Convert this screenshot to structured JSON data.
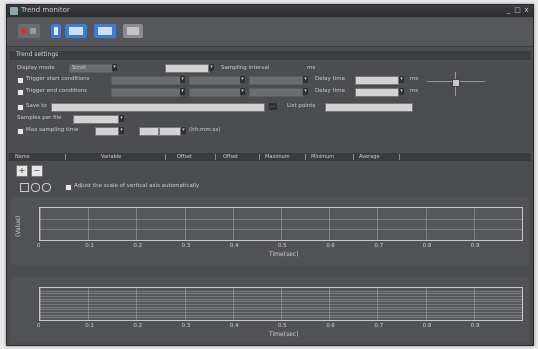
{
  "window": {
    "title": "Trend monitor",
    "controls": [
      "_",
      "□",
      "x"
    ]
  },
  "toolbar": {
    "icons": [
      "record-icon",
      "stop-icon",
      "pause-icon",
      "save-icon",
      "open-icon",
      "settings-icon"
    ]
  },
  "trend_settings": {
    "header": "Trend settings",
    "display_mode_label": "Display mode",
    "display_mode_value": "Scroll",
    "sampling_interval_label": "Sampling interval",
    "sampling_interval_unit": "ms",
    "trigger_start_label": "Trigger start conditions",
    "trigger_end_label": "Trigger end conditions",
    "delay_time_label": "Delay time",
    "delay_time_unit": "ms",
    "save_to_label": "Save to",
    "samples_label": "Samples per file",
    "max_sampling_time_label": "Max sampling time",
    "max_sampling_unit": "(hh:mm:ss)",
    "list_points_label": "List points"
  },
  "tabs": [
    "Name",
    "Variable",
    "Offset",
    "Offset",
    "Maximum",
    "Minimum",
    "Average"
  ],
  "plot_options": {
    "auto_scale_label": "Adjust the scale of vertical axis automatically"
  },
  "chart_data": [
    {
      "type": "line",
      "xlabel": "Time(sec)",
      "ylabel": "(Value)",
      "x_ticks": [
        "0",
        "0.1",
        "0.2",
        "0.3",
        "0.4",
        "0.5",
        "0.6",
        "0.7",
        "0.8",
        "0.9"
      ],
      "xlim": [
        0,
        1
      ],
      "grid": true
    },
    {
      "type": "line",
      "xlabel": "Time(sec)",
      "x_ticks": [
        "0",
        "0.1",
        "0.2",
        "0.3",
        "0.4",
        "0.5",
        "0.6",
        "0.7",
        "0.8",
        "0.9"
      ],
      "xlim": [
        0,
        1
      ],
      "grid": true
    }
  ]
}
